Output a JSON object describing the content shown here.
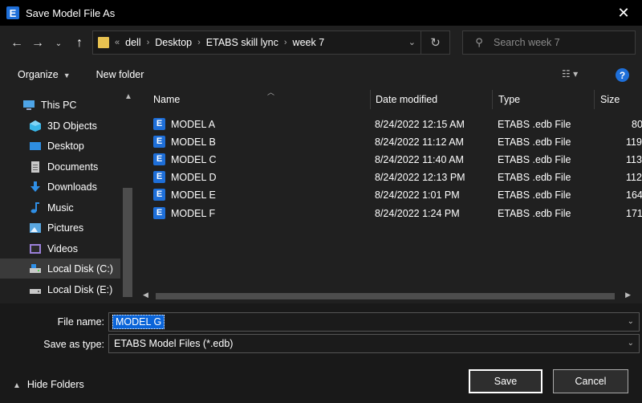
{
  "window": {
    "title": "Save Model File As",
    "app_icon_letter": "E"
  },
  "nav": {
    "breadcrumbs": [
      "dell",
      "Desktop",
      "ETABS skill lync",
      "week 7"
    ],
    "overflow": "«",
    "search_placeholder": "Search week 7"
  },
  "toolbar": {
    "organize": "Organize",
    "new_folder": "New folder"
  },
  "sidebar": {
    "items": [
      {
        "label": "This PC",
        "icon": "pc-icon",
        "color": "#4ea5e8"
      },
      {
        "label": "3D Objects",
        "icon": "cube-icon",
        "color": "#38b6e8"
      },
      {
        "label": "Desktop",
        "icon": "desktop-icon",
        "color": "#2e8de0"
      },
      {
        "label": "Documents",
        "icon": "documents-icon",
        "color": "#c9c9c9"
      },
      {
        "label": "Downloads",
        "icon": "download-icon",
        "color": "#2f8fe6"
      },
      {
        "label": "Music",
        "icon": "music-icon",
        "color": "#2f8fe6"
      },
      {
        "label": "Pictures",
        "icon": "pictures-icon",
        "color": "#5aa7e0"
      },
      {
        "label": "Videos",
        "icon": "videos-icon",
        "color": "#9a7fd8"
      },
      {
        "label": "Local Disk (C:)",
        "icon": "drive-icon",
        "color": "#c9c9c9"
      },
      {
        "label": "Local Disk (E:)",
        "icon": "drive-icon",
        "color": "#c9c9c9"
      }
    ],
    "selected_index": 8
  },
  "columns": {
    "name": "Name",
    "date": "Date modified",
    "type": "Type",
    "size": "Size"
  },
  "files": [
    {
      "name": "MODEL A",
      "date": "8/24/2022 12:15 AM",
      "type": "ETABS .edb File",
      "size": "80"
    },
    {
      "name": "MODEL B",
      "date": "8/24/2022 11:12 AM",
      "type": "ETABS .edb File",
      "size": "119"
    },
    {
      "name": "MODEL C",
      "date": "8/24/2022 11:40 AM",
      "type": "ETABS .edb File",
      "size": "113"
    },
    {
      "name": "MODEL D",
      "date": "8/24/2022 12:13 PM",
      "type": "ETABS .edb File",
      "size": "112"
    },
    {
      "name": "MODEL E",
      "date": "8/24/2022 1:01 PM",
      "type": "ETABS .edb File",
      "size": "164"
    },
    {
      "name": "MODEL F",
      "date": "8/24/2022 1:24 PM",
      "type": "ETABS .edb File",
      "size": "171"
    }
  ],
  "form": {
    "filename_label": "File name:",
    "filename_value": "MODEL G",
    "type_label": "Save as type:",
    "type_value": "ETABS Model Files (*.edb)"
  },
  "footer": {
    "hide_folders": "Hide Folders",
    "save": "Save",
    "cancel": "Cancel"
  },
  "colors": {
    "accent": "#1e6fd9",
    "selection": "#0a64d8",
    "folder": "#e8c250"
  }
}
